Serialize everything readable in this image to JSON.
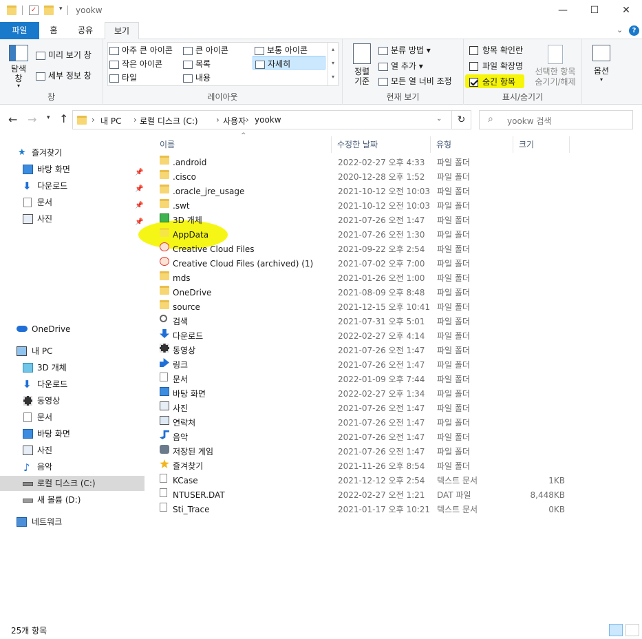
{
  "window": {
    "title": "yookw",
    "minimize": "—",
    "maximize": "☐",
    "close": "✕"
  },
  "tabs": [
    "파일",
    "홈",
    "공유",
    "보기"
  ],
  "ribbon": {
    "pane": {
      "navigation_pane": "탐색\n창",
      "preview_pane": "미리 보기 창",
      "details_pane": "세부 정보 창",
      "group": "창"
    },
    "layout": {
      "items": [
        "아주 큰 아이콘",
        "큰 아이콘",
        "보통 아이콘",
        "작은 아이콘",
        "목록",
        "자세히",
        "타일",
        "내용"
      ],
      "group": "레이아웃"
    },
    "current_view": {
      "sort_by": "정렬\n기준",
      "group_by": "분류 방법",
      "add_columns": "열 추가",
      "size_all_columns": "모든 열 너비 조정",
      "group": "현재 보기"
    },
    "show_hide": {
      "item_check_boxes": "항목 확인란",
      "file_name_extensions": "파일 확장명",
      "hidden_items": "숨긴 항목",
      "hide_selected": "선택한 항목\n숨기기/해제",
      "group": "표시/숨기기"
    },
    "options": "옵션"
  },
  "address": {
    "path": [
      "내 PC",
      "로컬 디스크 (C:)",
      "사용자",
      "yookw"
    ],
    "search_placeholder": "yookw 검색"
  },
  "nav": {
    "quick_access": "즐겨찾기",
    "quick_items": [
      "바탕 화면",
      "다운로드",
      "문서",
      "사진"
    ],
    "onedrive": "OneDrive",
    "this_pc": "내 PC",
    "pc_items": [
      "3D 개체",
      "다운로드",
      "동영상",
      "문서",
      "바탕 화면",
      "사진",
      "음악",
      "로컬 디스크 (C:)",
      "새 볼륨 (D:)"
    ],
    "network": "네트워크"
  },
  "columns": [
    "이름",
    "수정한 날짜",
    "유형",
    "크기"
  ],
  "files": [
    {
      "name": ".android",
      "date": "2022-02-27 오후 4:33",
      "type": "파일 폴더",
      "size": "",
      "icon": "folder"
    },
    {
      "name": ".cisco",
      "date": "2020-12-28 오후 1:52",
      "type": "파일 폴더",
      "size": "",
      "icon": "folder"
    },
    {
      "name": ".oracle_jre_usage",
      "date": "2021-10-12 오전 10:03",
      "type": "파일 폴더",
      "size": "",
      "icon": "folder"
    },
    {
      "name": ".swt",
      "date": "2021-10-12 오전 10:03",
      "type": "파일 폴더",
      "size": "",
      "icon": "folder"
    },
    {
      "name": "3D 개체",
      "date": "2021-07-26 오전 1:47",
      "type": "파일 폴더",
      "size": "",
      "icon": "cube"
    },
    {
      "name": "AppData",
      "date": "2021-07-26 오전 1:30",
      "type": "파일 폴더",
      "size": "",
      "icon": "folder-hidden"
    },
    {
      "name": "Creative Cloud Files",
      "date": "2021-09-22 오후 2:54",
      "type": "파일 폴더",
      "size": "",
      "icon": "cc"
    },
    {
      "name": "Creative Cloud Files (archived) (1)",
      "date": "2021-07-02 오후 7:00",
      "type": "파일 폴더",
      "size": "",
      "icon": "cc"
    },
    {
      "name": "mds",
      "date": "2021-01-26 오전 1:00",
      "type": "파일 폴더",
      "size": "",
      "icon": "folder"
    },
    {
      "name": "OneDrive",
      "date": "2021-08-09 오후 8:48",
      "type": "파일 폴더",
      "size": "",
      "icon": "folder"
    },
    {
      "name": "source",
      "date": "2021-12-15 오후 10:41",
      "type": "파일 폴더",
      "size": "",
      "icon": "folder"
    },
    {
      "name": "검색",
      "date": "2021-07-31 오후 5:01",
      "type": "파일 폴더",
      "size": "",
      "icon": "search"
    },
    {
      "name": "다운로드",
      "date": "2022-02-27 오후 4:14",
      "type": "파일 폴더",
      "size": "",
      "icon": "download"
    },
    {
      "name": "동영상",
      "date": "2021-07-26 오전 1:47",
      "type": "파일 폴더",
      "size": "",
      "icon": "video"
    },
    {
      "name": "링크",
      "date": "2021-07-26 오전 1:47",
      "type": "파일 폴더",
      "size": "",
      "icon": "link"
    },
    {
      "name": "문서",
      "date": "2022-01-09 오후 7:44",
      "type": "파일 폴더",
      "size": "",
      "icon": "document"
    },
    {
      "name": "바탕 화면",
      "date": "2022-02-27 오후 1:34",
      "type": "파일 폴더",
      "size": "",
      "icon": "desktop"
    },
    {
      "name": "사진",
      "date": "2021-07-26 오전 1:47",
      "type": "파일 폴더",
      "size": "",
      "icon": "picture"
    },
    {
      "name": "연락처",
      "date": "2021-07-26 오전 1:47",
      "type": "파일 폴더",
      "size": "",
      "icon": "contact"
    },
    {
      "name": "음악",
      "date": "2021-07-26 오전 1:47",
      "type": "파일 폴더",
      "size": "",
      "icon": "music"
    },
    {
      "name": "저장된 게임",
      "date": "2021-07-26 오전 1:47",
      "type": "파일 폴더",
      "size": "",
      "icon": "game"
    },
    {
      "name": "즐겨찾기",
      "date": "2021-11-26 오후 8:54",
      "type": "파일 폴더",
      "size": "",
      "icon": "star"
    },
    {
      "name": "KCase",
      "date": "2021-12-12 오후 2:54",
      "type": "텍스트 문서",
      "size": "1KB",
      "icon": "text"
    },
    {
      "name": "NTUSER.DAT",
      "date": "2022-02-27 오전 1:21",
      "type": "DAT 파일",
      "size": "8,448KB",
      "icon": "file"
    },
    {
      "name": "Sti_Trace",
      "date": "2021-01-17 오후 10:21",
      "type": "텍스트 문서",
      "size": "0KB",
      "icon": "text"
    }
  ],
  "status": {
    "count": "25개 항목"
  }
}
